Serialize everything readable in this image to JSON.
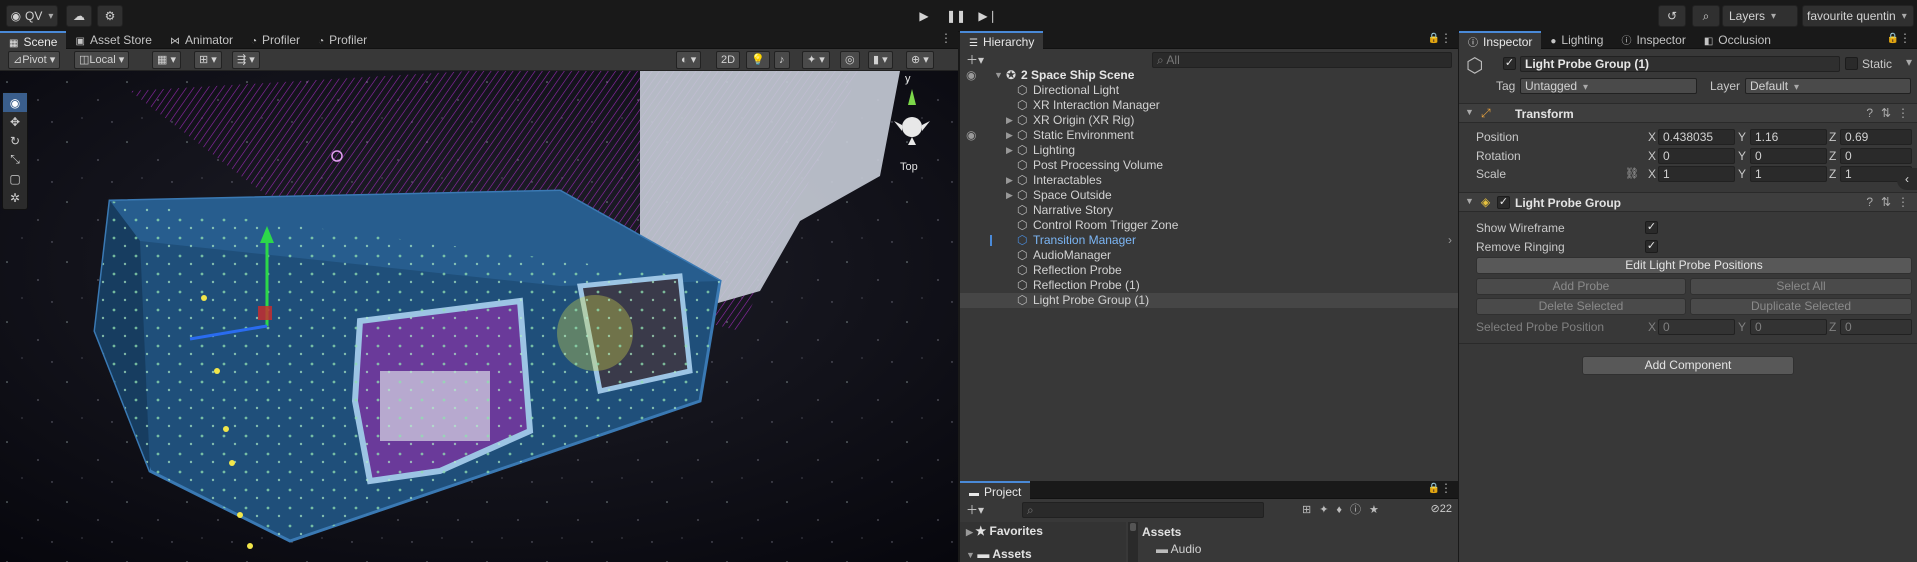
{
  "toolbar": {
    "account": "QV",
    "layers": "Layers",
    "layout": "favourite quentin"
  },
  "scene_tabs": [
    "Scene",
    "Asset Store",
    "Animator",
    "Profiler",
    "Profiler"
  ],
  "scene_toolbar": {
    "pivot": "Pivot",
    "local": "Local",
    "mode_2d": "2D"
  },
  "gizmo": {
    "axis_y": "y",
    "view": "Top"
  },
  "hierarchy": {
    "tab": "Hierarchy",
    "search_placeholder": "All",
    "scene": "2 Space Ship Scene",
    "items": [
      {
        "label": "Directional Light",
        "expandable": false
      },
      {
        "label": "XR Interaction Manager",
        "expandable": false
      },
      {
        "label": "XR Origin (XR Rig)",
        "expandable": true
      },
      {
        "label": "Static Environment",
        "expandable": true
      },
      {
        "label": "Lighting",
        "expandable": true
      },
      {
        "label": "Post Processing Volume",
        "expandable": false
      },
      {
        "label": "Interactables",
        "expandable": true
      },
      {
        "label": "Space Outside",
        "expandable": true
      },
      {
        "label": "Narrative Story",
        "expandable": false
      },
      {
        "label": "Control Room Trigger Zone",
        "expandable": false
      },
      {
        "label": "Transition Manager",
        "expandable": false,
        "prefab": true
      },
      {
        "label": "AudioManager",
        "expandable": false
      },
      {
        "label": "Reflection Probe",
        "expandable": false
      },
      {
        "label": "Reflection Probe (1)",
        "expandable": false
      },
      {
        "label": "Light Probe Group (1)",
        "expandable": false,
        "selected": true
      }
    ]
  },
  "project": {
    "tab": "Project",
    "count": "22",
    "favorites": "Favorites",
    "assets": "Assets",
    "assets_header": "Assets",
    "folder": "Audio"
  },
  "inspector_tabs": [
    "Inspector",
    "Lighting",
    "Inspector",
    "Occlusion"
  ],
  "inspector": {
    "object_name": "Light Probe Group (1)",
    "static_label": "Static",
    "tag_label": "Tag",
    "tag": "Untagged",
    "layer_label": "Layer",
    "layer": "Default",
    "transform": {
      "title": "Transform",
      "position_label": "Position",
      "rotation_label": "Rotation",
      "scale_label": "Scale",
      "position": {
        "x": "0.438035",
        "y": "1.16",
        "z": "0.69"
      },
      "rotation": {
        "x": "0",
        "y": "0",
        "z": "0"
      },
      "scale": {
        "x": "1",
        "y": "1",
        "z": "1"
      }
    },
    "light_probe_group": {
      "title": "Light Probe Group",
      "show_wireframe_label": "Show Wireframe",
      "show_wireframe": true,
      "remove_ringing_label": "Remove Ringing",
      "remove_ringing": true,
      "edit_button": "Edit Light Probe Positions",
      "add_probe": "Add Probe",
      "select_all": "Select All",
      "delete_selected": "Delete Selected",
      "duplicate_selected": "Duplicate Selected",
      "selected_probe_position_label": "Selected Probe Position",
      "selected_probe_position": {
        "x": "0",
        "y": "0",
        "z": "0"
      }
    },
    "add_component": "Add Component"
  },
  "axis_labels": {
    "x": "X",
    "y": "Y",
    "z": "Z"
  },
  "colors": {
    "accent": "#4a8ad8",
    "selection": "#464646",
    "probe_lines": "#c030e0",
    "hull": "#1f4f7a",
    "probe_dot": "#f2e64a"
  }
}
